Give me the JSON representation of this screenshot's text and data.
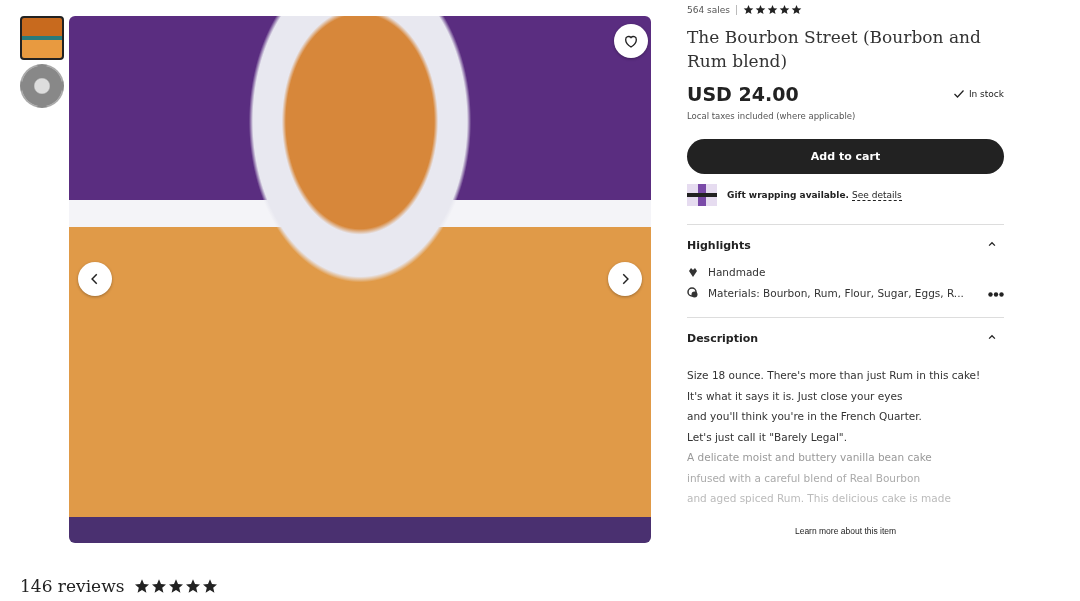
{
  "gallery": {
    "thumbnails": [
      {
        "kind": "photo",
        "selected": true
      },
      {
        "kind": "badge",
        "selected": false
      }
    ],
    "favorited": false
  },
  "reviews": {
    "count": "146 reviews",
    "stars": 5
  },
  "listing": {
    "sales": "564 sales",
    "stars": 5,
    "title": "The Bourbon Street (Bourbon and Rum blend)",
    "price": "USD 24.00",
    "stock": "In stock",
    "taxes": "Local taxes included (where applicable)",
    "cart_button": "Add to cart",
    "gift": {
      "text": "Gift wrapping available.",
      "link": "See details"
    },
    "highlights": {
      "title": "Highlights",
      "expanded": true,
      "items": [
        {
          "kind": "handmade",
          "text": "Handmade"
        },
        {
          "kind": "materials",
          "text": "Materials: Bourbon, Rum, Flour, Sugar, Eggs, R..."
        }
      ]
    },
    "description": {
      "title": "Description",
      "expanded": true,
      "lines": [
        "Size 18 ounce. There's more than just Rum in this cake!",
        "It's what it says it is. Just close your eyes",
        "and you'll think you're in the French Quarter.",
        "Let's just call it \"Barely Legal\".",
        "A delicate moist and buttery vanilla bean cake",
        "infused with a careful blend of Real Bourbon",
        "and aged spiced Rum. This delicious cake is made"
      ]
    },
    "learn_more": "Learn more about this item"
  }
}
